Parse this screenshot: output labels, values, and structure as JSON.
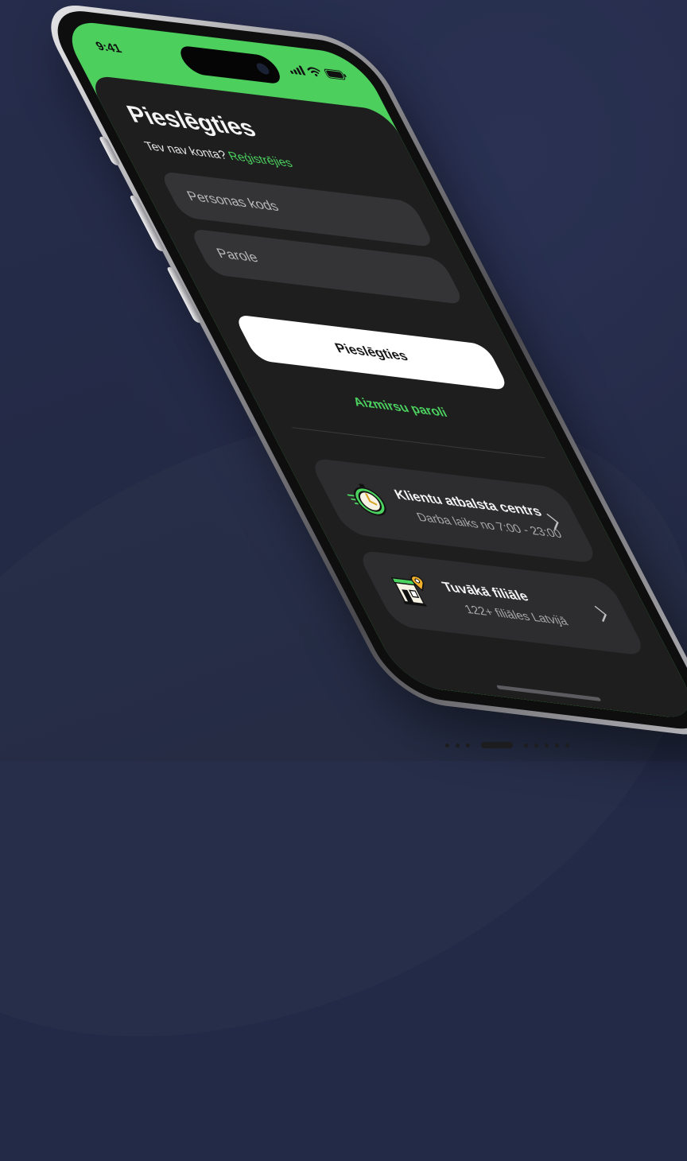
{
  "status_bar": {
    "time": "9:41",
    "icons": [
      "signal-icon",
      "wifi-icon",
      "battery-icon"
    ]
  },
  "login": {
    "title": "Pieslēgties",
    "signup_prompt": "Tev nav konta?",
    "signup_link": "Reģistrējies",
    "id_placeholder": "Personas kods",
    "password_placeholder": "Parole",
    "submit_label": "Pieslēgties",
    "forgot_label": "Aizmirsu paroli"
  },
  "cards": {
    "support": {
      "title": "Klientu atbalsta centrs",
      "subtitle": "Darba laiks no 7:00 - 23:00",
      "icon": "clock-icon"
    },
    "branch": {
      "title": "Tuvākā filiāle",
      "subtitle": "122+ filiāles Latvijā",
      "icon": "store-location-icon"
    }
  },
  "colors": {
    "accent": "#4cd35f",
    "background": "#232a47",
    "sheet": "#1e1e1f",
    "field": "#343436",
    "card": "#2d2d2f"
  }
}
